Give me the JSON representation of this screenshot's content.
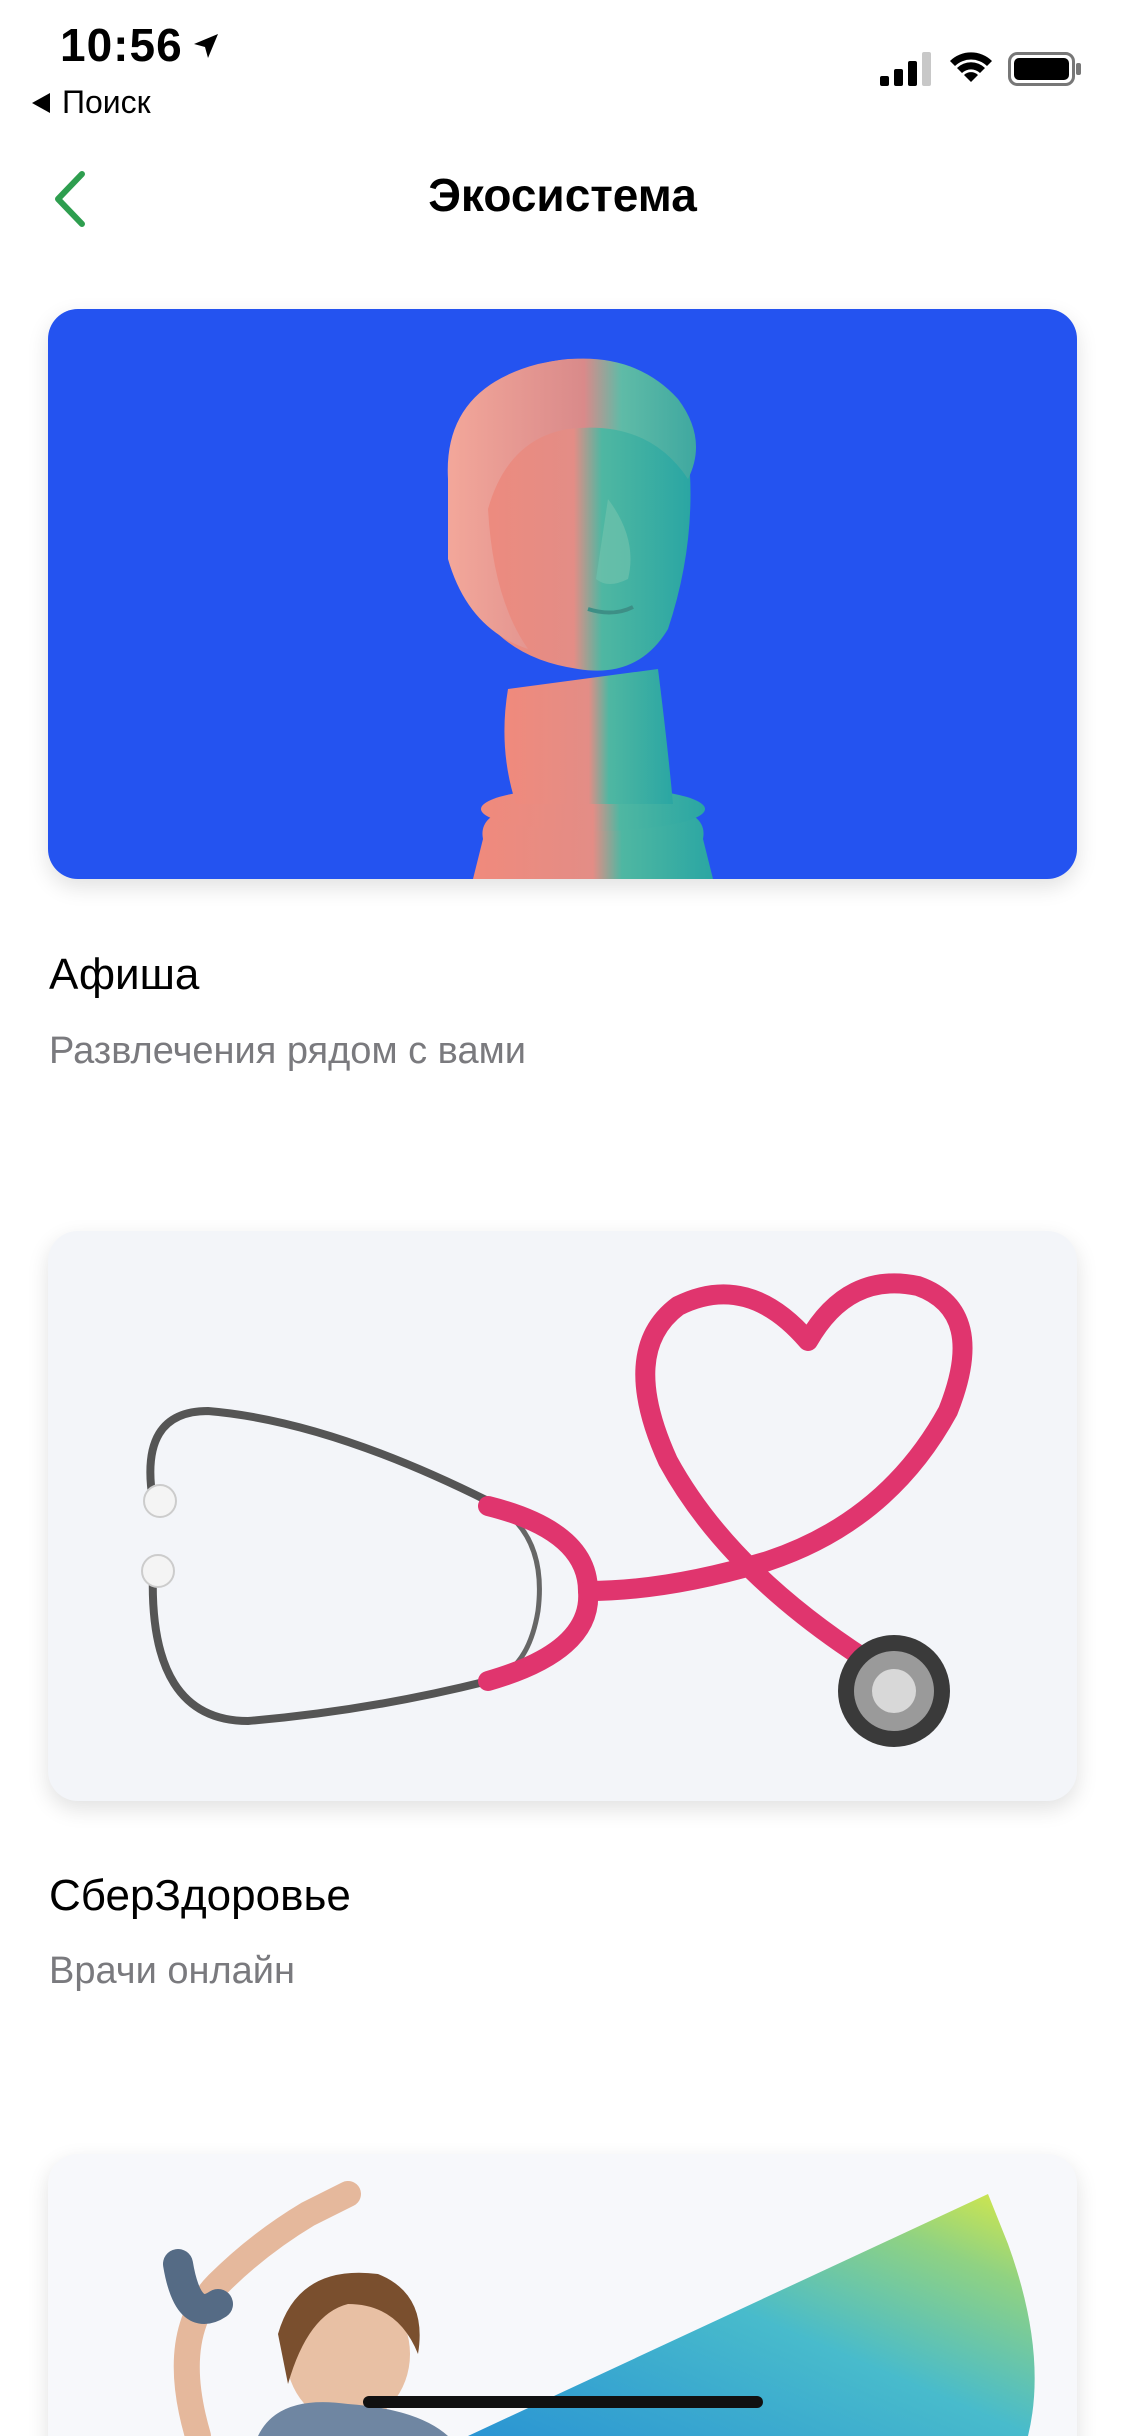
{
  "status_bar": {
    "time": "10:56",
    "back_app_label": "Поиск",
    "icons": [
      "location-arrow-icon",
      "cellular-signal-icon",
      "wifi-icon",
      "battery-icon"
    ]
  },
  "nav": {
    "title": "Экосистема",
    "back_icon": "chevron-left-icon",
    "accent_color": "#2e9e4f"
  },
  "cards": [
    {
      "title": "Афиша",
      "subtitle": "Развлечения рядом с вами",
      "image": "classical-bust-illustration",
      "background": "#2453f0"
    },
    {
      "title": "СберЗдоровье",
      "subtitle": "Врачи онлайн",
      "image": "stethoscope-heart-illustration",
      "background": "#f3f5f9"
    },
    {
      "image": "dancing-woman-illustration",
      "background": "#f7f8fb"
    }
  ]
}
